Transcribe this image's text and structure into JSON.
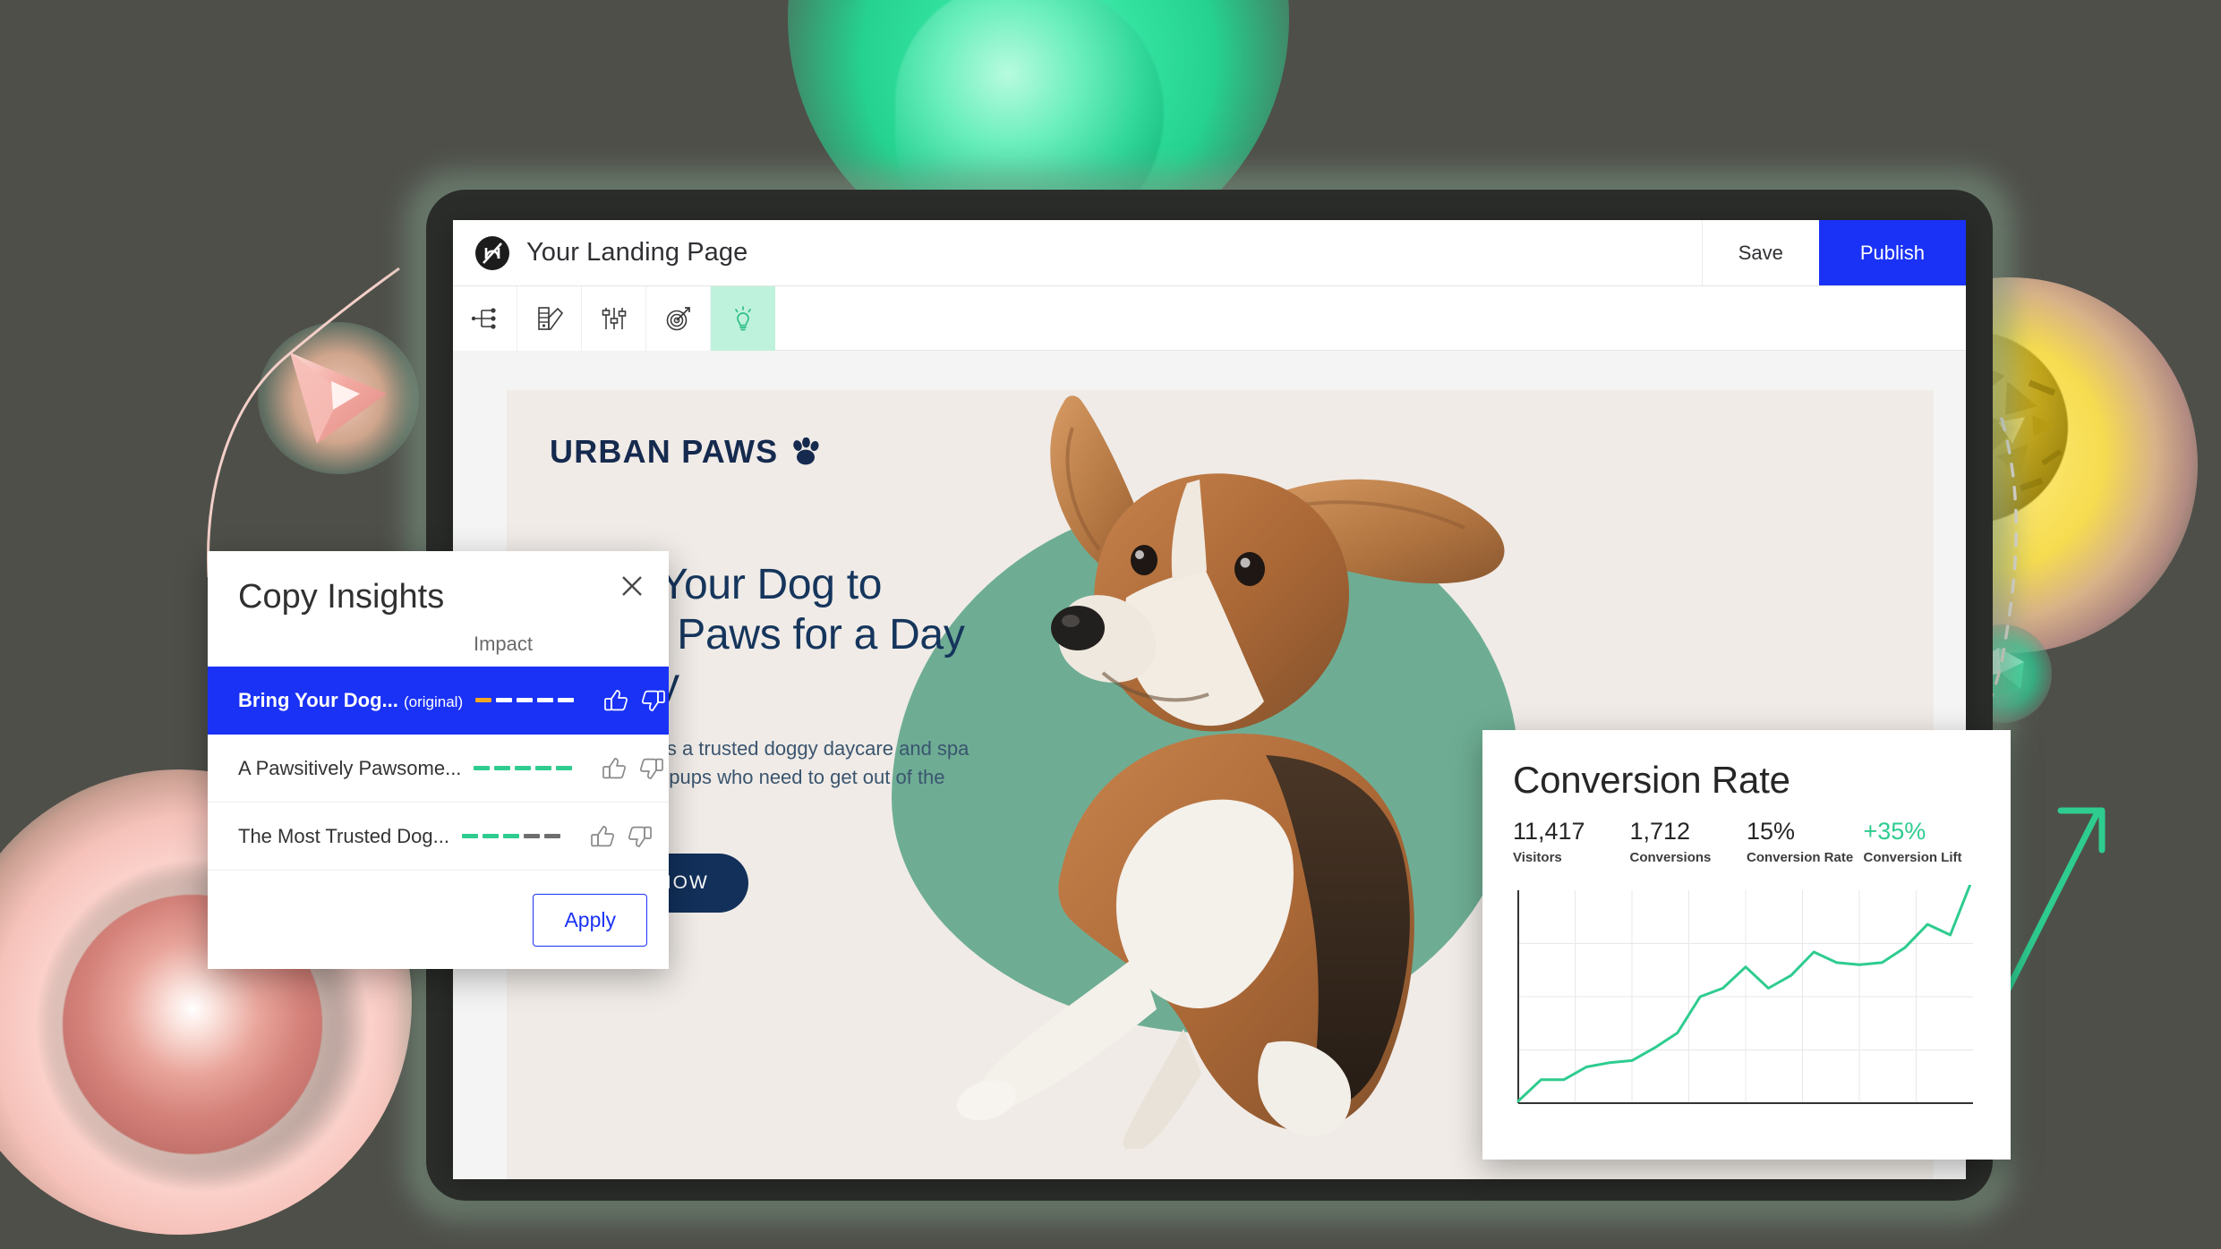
{
  "background_color": "#4E4F49",
  "app": {
    "logo_icon": "unbounce-logo-icon",
    "page_title": "Your Landing Page",
    "save_label": "Save",
    "publish_label": "Publish",
    "publish_color": "#1A32F5",
    "toolbar": [
      {
        "name": "page-structure",
        "icon": "flow-branch-icon",
        "active": false
      },
      {
        "name": "styles",
        "icon": "color-palette-icon",
        "active": false
      },
      {
        "name": "settings",
        "icon": "sliders-icon",
        "active": false
      },
      {
        "name": "goals",
        "icon": "target-icon",
        "active": false
      },
      {
        "name": "insights",
        "icon": "lightbulb-icon",
        "active": true
      }
    ],
    "toolbar_active_color": "#BFF2DC"
  },
  "landing_page": {
    "brand": "URBAN PAWS",
    "brand_icon": "paw-print-icon",
    "brand_color": "#152A4E",
    "headline": "Bring Your Dog to Urban Paws for a Day of Play",
    "body": "Urban Paws is a trusted doggy daycare and spa that caters to pups who need to get out of the house.",
    "cta_label": "BOOK NOW",
    "cta_color": "#12305A",
    "blob_color": "#6EAD94",
    "surface_color": "#F0EBE7",
    "hero_image": "beagle-dog-photo"
  },
  "insights_panel": {
    "title": "Copy Insights",
    "close_icon": "close-icon",
    "impact_column_header": "Impact",
    "apply_label": "Apply",
    "selected_color": "#1A32F5",
    "rows": [
      {
        "label": "Bring Your Dog...",
        "suffix": "(original)",
        "selected": true,
        "impact_dashes": [
          "#F5A623",
          "#FFFFFF",
          "#FFFFFF",
          "#FFFFFF",
          "#FFFFFF"
        ],
        "thumb_up_icon": "thumb-up-icon",
        "thumb_down_icon": "thumb-down-icon"
      },
      {
        "label": "A Pawsitively Pawsome...",
        "suffix": "",
        "selected": false,
        "impact_dashes": [
          "#2ECC8F",
          "#2ECC8F",
          "#2ECC8F",
          "#2ECC8F",
          "#2ECC8F"
        ],
        "thumb_up_icon": "thumb-up-icon",
        "thumb_down_icon": "thumb-down-icon"
      },
      {
        "label": "The Most Trusted Dog...",
        "suffix": "",
        "selected": false,
        "impact_dashes": [
          "#2ECC8F",
          "#2ECC8F",
          "#2ECC8F",
          "#6E6E6E",
          "#6E6E6E"
        ],
        "thumb_up_icon": "thumb-up-icon",
        "thumb_down_icon": "thumb-down-icon"
      }
    ]
  },
  "conversion_card": {
    "title": "Conversion Rate",
    "stats": [
      {
        "value": "11,417",
        "label": "Visitors",
        "highlight": false
      },
      {
        "value": "1,712",
        "label": "Conversions",
        "highlight": false
      },
      {
        "value": "15%",
        "label": "Conversion Rate",
        "highlight": false
      },
      {
        "value": "+35%",
        "label": "Conversion Lift",
        "highlight": true
      }
    ],
    "accent_color": "#2ECC8F"
  },
  "chart_data": {
    "type": "line",
    "title": "Conversion Rate",
    "xlabel": "",
    "ylabel": "",
    "grid": true,
    "legend": null,
    "ylim": [
      0,
      10
    ],
    "xlim": [
      0,
      20
    ],
    "series": [
      {
        "name": "Conversion Rate",
        "color": "#2ECC8F",
        "x": [
          0,
          1,
          2,
          3,
          4,
          5,
          6,
          7,
          8,
          9,
          10,
          11,
          12,
          13,
          14,
          15,
          16,
          17,
          18,
          19,
          20
        ],
        "values": [
          0.1,
          1.1,
          1.1,
          1.7,
          1.9,
          2.0,
          2.6,
          3.3,
          5.0,
          5.4,
          6.4,
          5.4,
          6.0,
          7.1,
          6.6,
          6.5,
          6.6,
          7.3,
          8.4,
          7.9,
          10.6
        ]
      }
    ],
    "annotation": "arrow-up-right-icon"
  },
  "decorations": [
    {
      "name": "green-glow-orb",
      "color": "#2FD698"
    },
    {
      "name": "gold-faceted-sphere",
      "color": "#DFC53A"
    },
    {
      "name": "pink-glow-orb",
      "color": "#E9A59B"
    },
    {
      "name": "pink-cone-marker",
      "color": "#F0A8A0"
    },
    {
      "name": "green-gem-marker",
      "color": "#3FD39B"
    },
    {
      "name": "pink-connector-string",
      "color": "#F3CFC8"
    },
    {
      "name": "dashed-connector-string",
      "color": "#E8DCD6"
    }
  ]
}
